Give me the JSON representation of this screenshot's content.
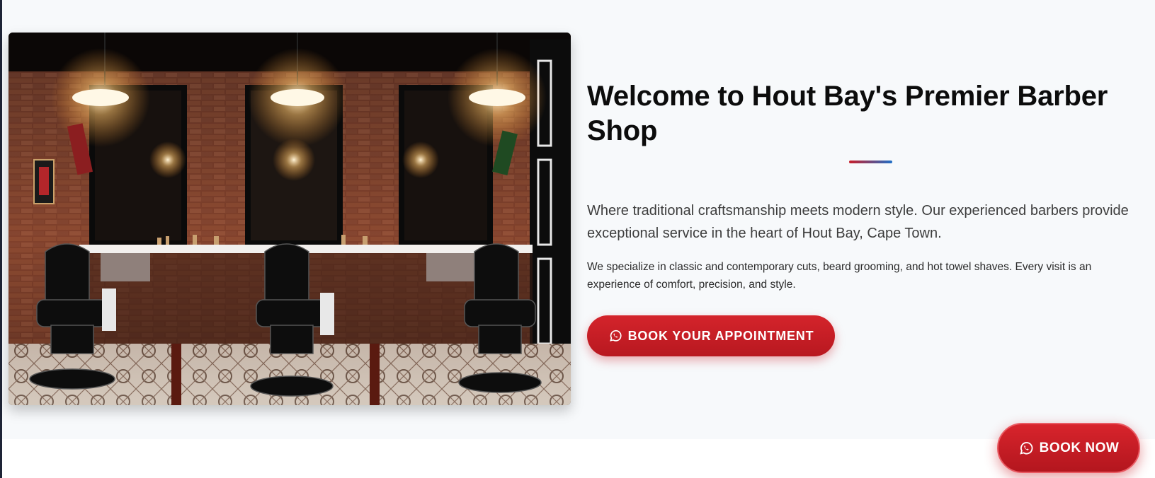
{
  "about": {
    "title": "Welcome to Hout Bay's Premier Barber Shop",
    "lead": "Where traditional craftsmanship meets modern style. Our experienced barbers provide exceptional service in the heart of Hout Bay, Cape Town.",
    "body": "We specialize in classic and contemporary cuts, beard grooming, and hot towel shaves. Every visit is an experience of comfort, precision, and style.",
    "cta_label": "BOOK YOUR APPOINTMENT",
    "cta_icon": "whatsapp-icon",
    "image_alt": "barbershop-interior-photo"
  },
  "floating_button": {
    "label": "BOOK NOW",
    "icon": "whatsapp-icon"
  },
  "colors": {
    "accent_red": "#c81e2a",
    "accent_blue": "#1f6fc7",
    "section_bg": "#f7f9fb"
  }
}
